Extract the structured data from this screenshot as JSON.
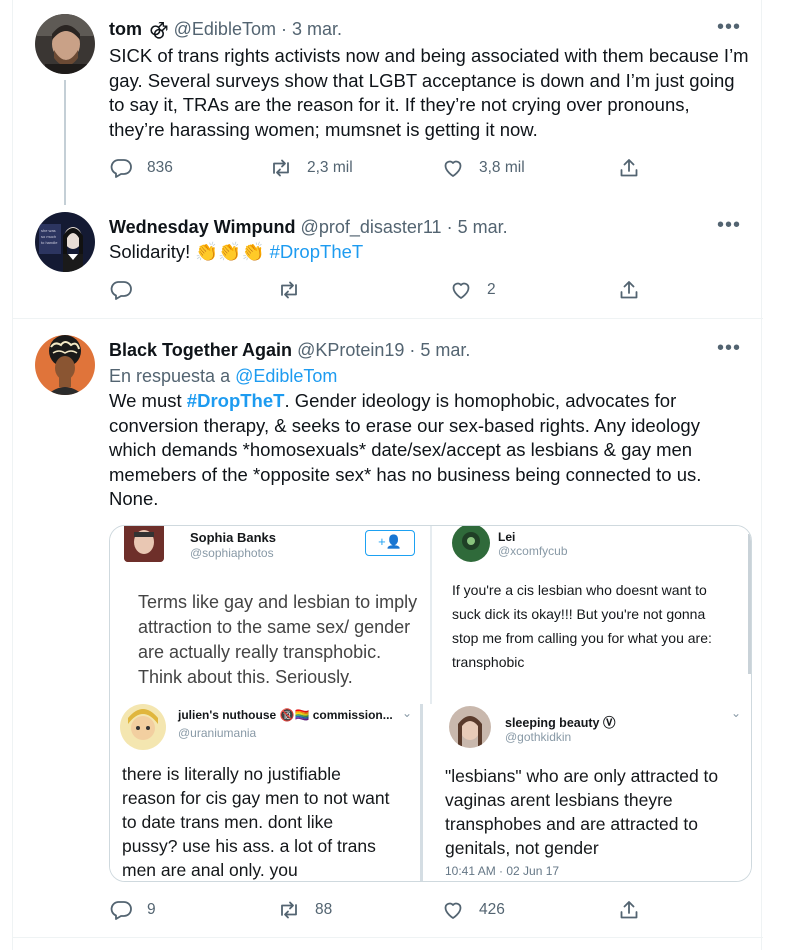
{
  "tweets": [
    {
      "name": "tom",
      "name_badge": "⚣",
      "handle": "@EdibleTom",
      "date": "· 3 mar.",
      "text": "SICK of trans rights activists now and being associated with them because I’m gay. Several surveys show that LGBT acceptance is down and I’m just going to say it, TRAs are the reason for it. If they’re not crying over pronouns, they’re harassing women; mumsnet is getting it now.",
      "replies": "836",
      "retweets": "2,3 mil",
      "likes": "3,8 mil"
    },
    {
      "name": "Wednesday Wimpund",
      "handle": "@prof_disaster11",
      "date": "· 5 mar.",
      "text": "Solidarity!",
      "emoji": "👏👏👏",
      "hashtag": "#DropTheT",
      "replies": "",
      "retweets": "",
      "likes": "2"
    },
    {
      "name": "Black Together Again",
      "handle": "@KProtein19",
      "date": "· 5 mar.",
      "reply_prefix": "En respuesta a",
      "reply_to": "@EdibleTom",
      "text_a": "We must",
      "hashtag": "#DropTheT",
      "text_b": ". Gender ideology is homophobic, advocates for conversion therapy, & seeks to erase our sex-based rights. Any ideology which demands *homosexuals* date/sex/accept as lesbians & gay men memebers of the *opposite sex* has no business being connected to us. None.",
      "replies": "9",
      "retweets": "88",
      "likes": "426"
    }
  ],
  "media": {
    "panel1": {
      "name": "Sophia Banks",
      "handle": "@sophiaphotos",
      "follow_label": "+👤",
      "text": "Terms like gay and lesbian to imply attraction to the same sex/ gender are actually really transphobic. Think about this. Seriously."
    },
    "panel2": {
      "name": "Lei",
      "handle": "@xcomfycub",
      "text": "If you're a cis lesbian who doesnt want to suck dick its okay!!! But you're not gonna stop me from calling you for what you are: transphobic"
    },
    "panel3": {
      "name": "julien's nuthouse 🔞🏳️‍🌈 commission...",
      "handle": "@uraniumania",
      "text": "there is literally no justifiable reason for cis gay men to not want to date trans men. dont like pussy? use his ass. a lot of trans men are anal only. you"
    },
    "panel4": {
      "name": "sleeping beauty Ⓥ",
      "handle": "@gothkidkin",
      "text": "\"lesbians\" who are only attracted to vaginas arent lesbians theyre transphobes and are attracted to genitals, not gender",
      "timestamp": "10:41 AM · 02 Jun 17"
    }
  },
  "icons": {
    "reply": "reply-icon",
    "retweet": "retweet-icon",
    "like": "heart-icon",
    "share": "share-icon",
    "more": "more-icon"
  },
  "colors": {
    "accent": "#1d9bf0",
    "secondary_text": "#536471",
    "divider": "#eff3f4"
  }
}
